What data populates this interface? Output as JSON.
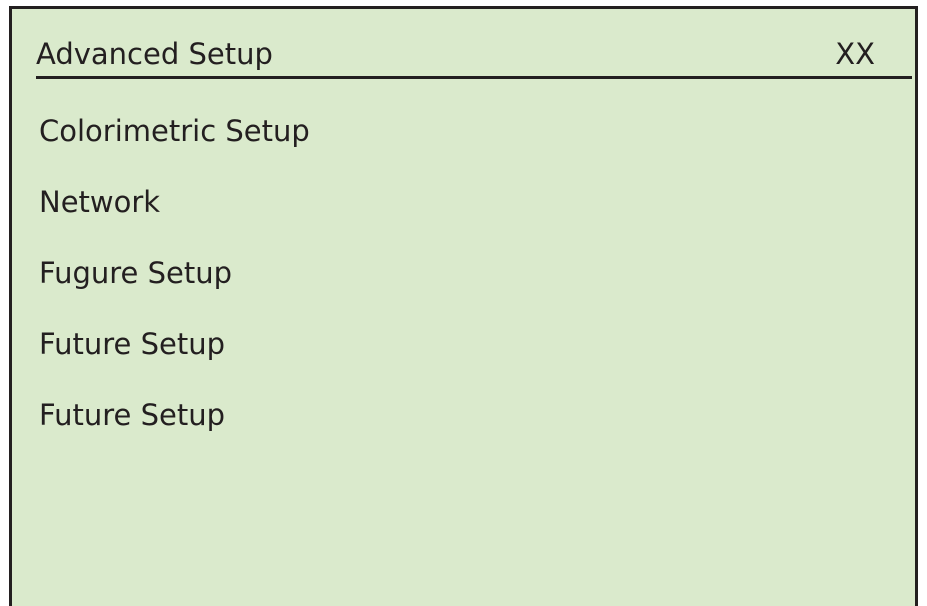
{
  "header": {
    "title": "Advanced Setup",
    "code": "XX"
  },
  "menu": {
    "items": [
      {
        "label": "Colorimetric Setup"
      },
      {
        "label": "Network"
      },
      {
        "label": "Fugure Setup"
      },
      {
        "label": "Future Setup"
      },
      {
        "label": "Future Setup"
      }
    ]
  },
  "colors": {
    "background": "#daeacc",
    "text": "#231f20",
    "border": "#231f20"
  }
}
